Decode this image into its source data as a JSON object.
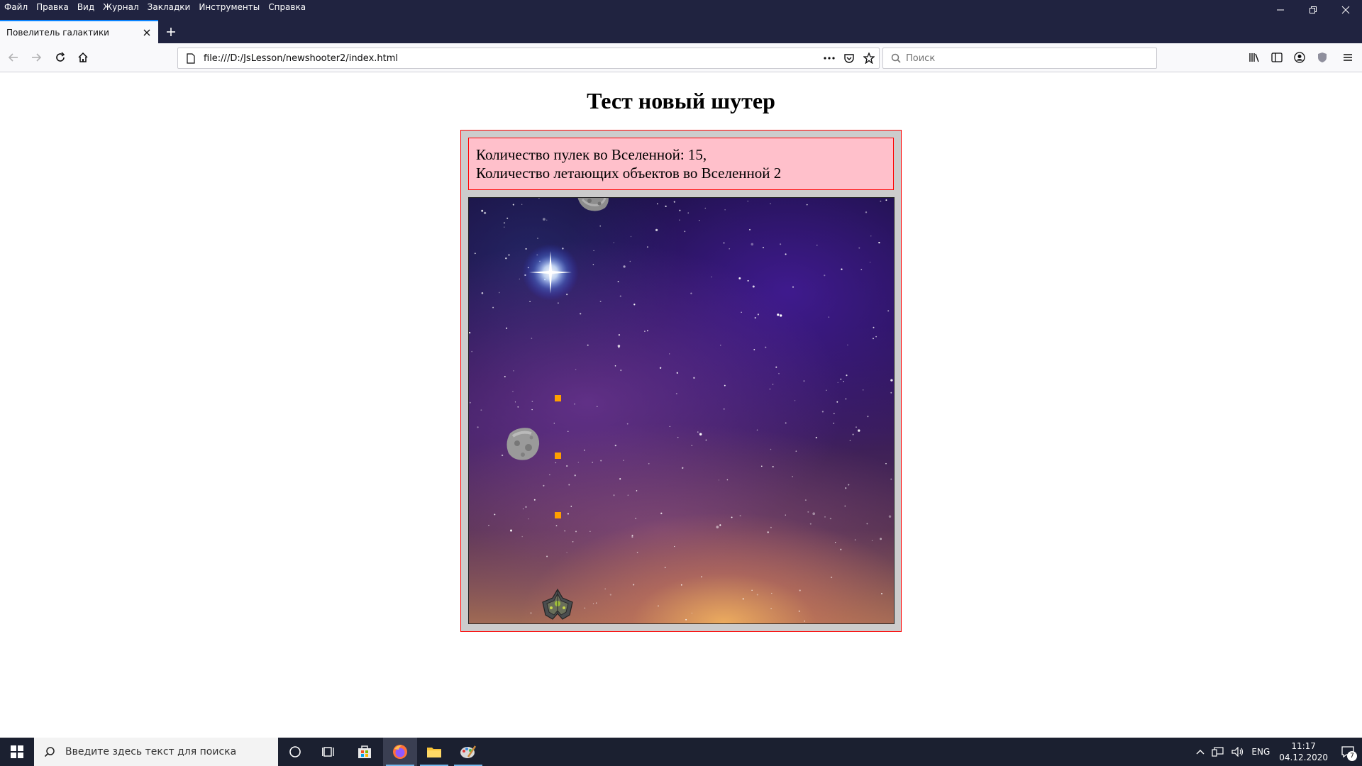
{
  "browser": {
    "menu": [
      "Файл",
      "Правка",
      "Вид",
      "Журнал",
      "Закладки",
      "Инструменты",
      "Справка"
    ],
    "tab_title": "Повелитель галактики",
    "url": "file:///D:/JsLesson/newshooter2/index.html",
    "search_placeholder": "Поиск",
    "accent_color": "#0a84ff",
    "titlebar_color": "#202340"
  },
  "page": {
    "title": "Тест новый шутер",
    "stats_line1": "Количество пулек во Вселенной: 15,",
    "stats_line2": "Количество летающих объектов во Вселенной 2",
    "panel_background": "#ffc0cb",
    "frame_border": "#ff0000",
    "bullet_color": "#ff9f00"
  },
  "taskbar": {
    "search_placeholder": "Введите здесь текст для поиска",
    "language": "ENG",
    "time": "11:17",
    "date": "04.12.2020",
    "notification_count": "7",
    "pinned_icons": [
      "cortana-icon",
      "task-view-icon",
      "store-icon",
      "firefox-icon",
      "file-explorer-icon",
      "paint-icon"
    ]
  }
}
